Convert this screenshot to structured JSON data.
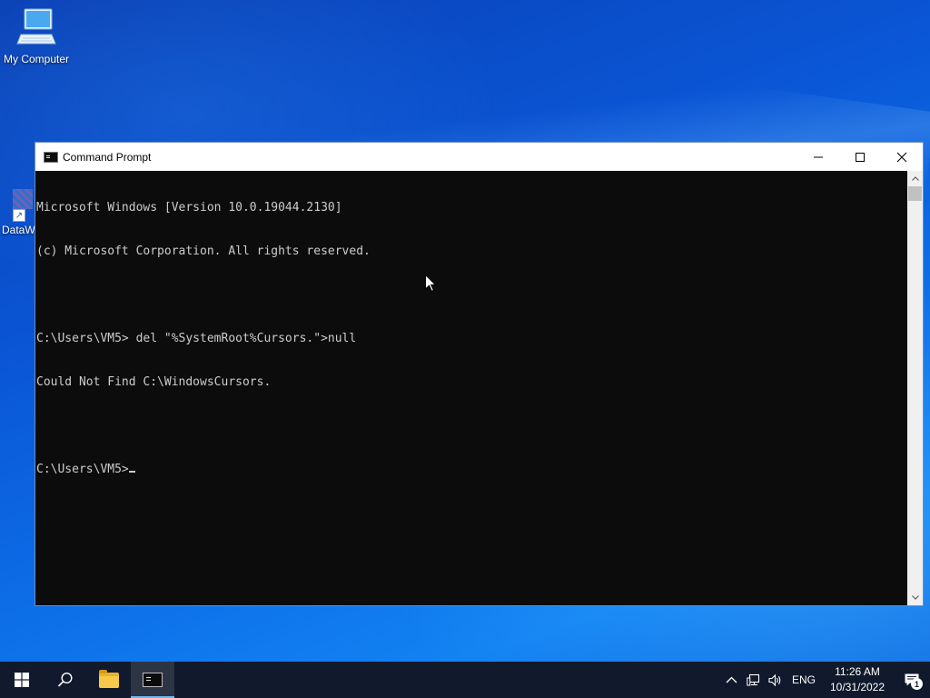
{
  "desktop": {
    "icons": [
      {
        "label": "My Computer"
      },
      {
        "label": "DataW"
      }
    ]
  },
  "window": {
    "title": "Command Prompt",
    "console_lines": [
      "Microsoft Windows [Version 10.0.19044.2130]",
      "(c) Microsoft Corporation. All rights reserved.",
      "",
      "C:\\Users\\VM5> del \"%SystemRoot%Cursors.\">null",
      "Could Not Find C:\\WindowsCursors.",
      "",
      "C:\\Users\\VM5>"
    ]
  },
  "taskbar": {
    "language": "ENG",
    "time": "11:26 AM",
    "date": "10/31/2022",
    "notification_count": "1"
  },
  "colors": {
    "console_bg": "#0c0c0c",
    "console_fg": "#cccccc",
    "taskbar_bg": "#101a2c",
    "accent": "#76b9ed"
  },
  "icons": [
    "computer-icon",
    "shortcut-icon",
    "cmd-icon",
    "minimize-icon",
    "maximize-icon",
    "close-icon",
    "windows-start-icon",
    "search-icon",
    "file-explorer-icon",
    "chevron-up-icon",
    "network-icon",
    "volume-icon",
    "notification-icon",
    "mouse-pointer-icon"
  ]
}
